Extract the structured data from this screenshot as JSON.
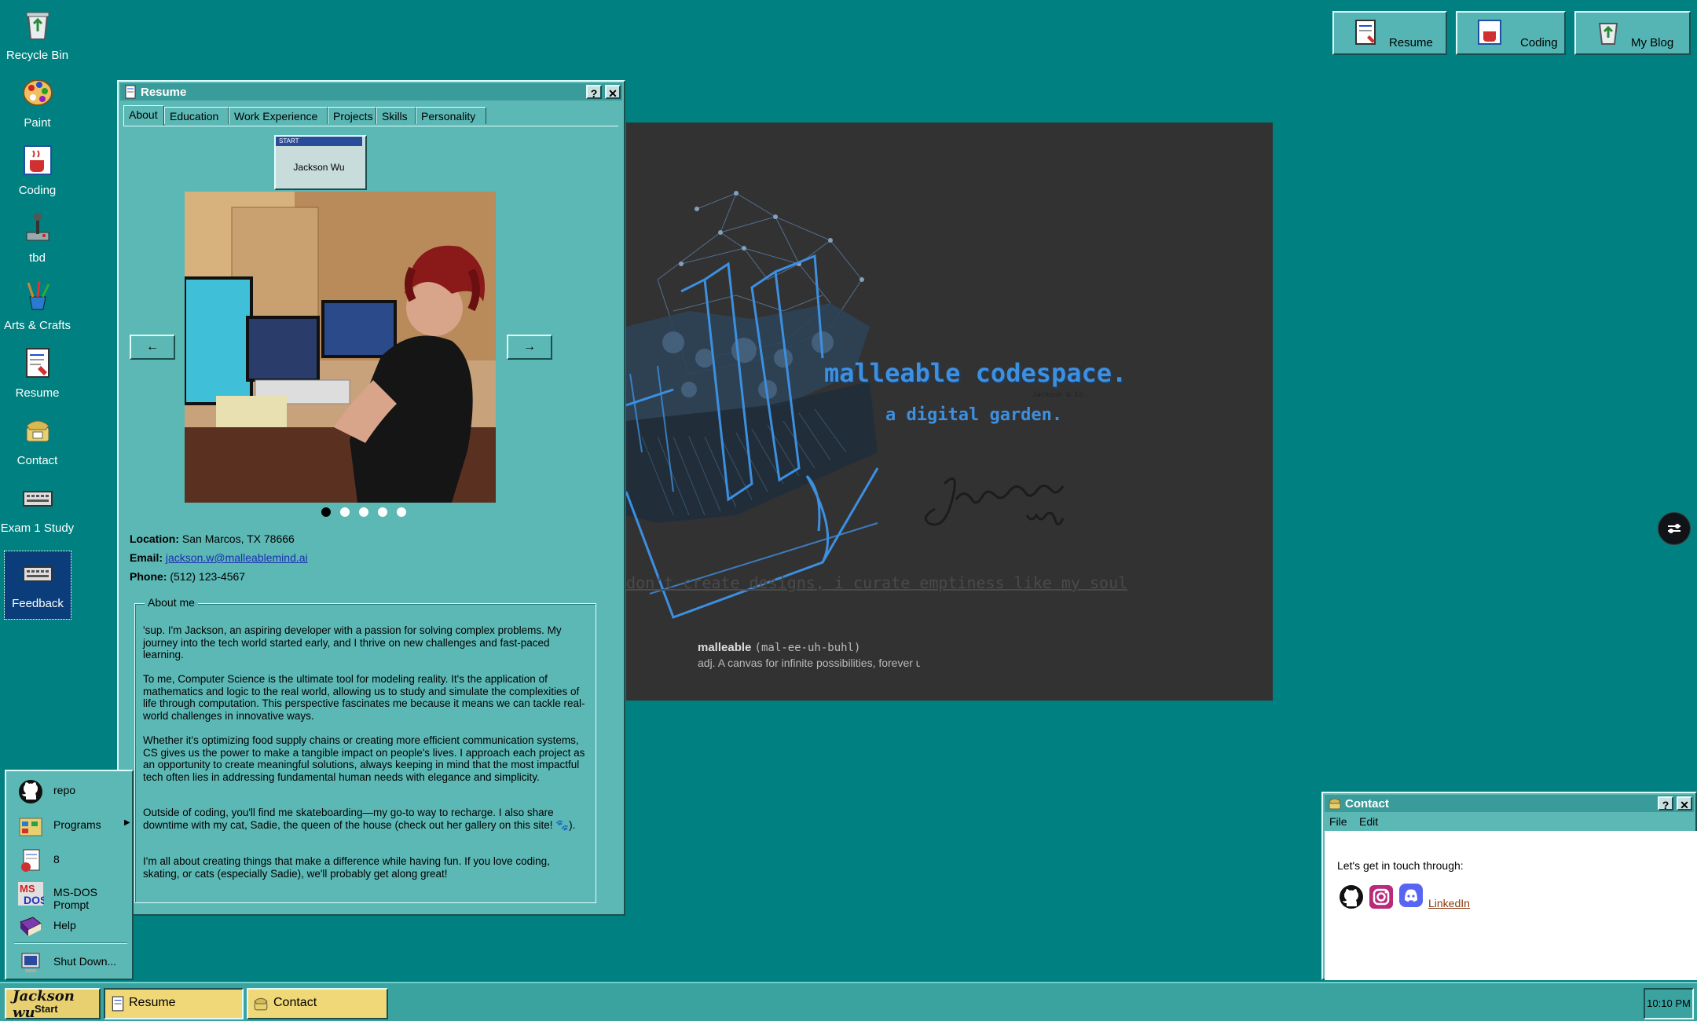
{
  "desktop": {
    "icons": [
      {
        "label": "Recycle Bin",
        "icon": "recycle-bin-icon"
      },
      {
        "label": "Paint",
        "icon": "paint-palette-icon"
      },
      {
        "label": "Coding",
        "icon": "coding-cup-icon"
      },
      {
        "label": "tbd",
        "icon": "joystick-icon"
      },
      {
        "label": "Arts & Crafts",
        "icon": "brushes-icon"
      },
      {
        "label": "Resume",
        "icon": "document-icon"
      },
      {
        "label": "Contact",
        "icon": "phone-icon"
      },
      {
        "label": "Exam 1 Study",
        "icon": "keyboard-icon"
      },
      {
        "label": "Feedback",
        "icon": "keyboard-icon"
      }
    ]
  },
  "quick_launch": [
    {
      "label": "Resume",
      "icon": "document-icon"
    },
    {
      "label": "Coding",
      "icon": "coding-cup-icon"
    },
    {
      "label": "My Blog",
      "icon": "recycle-bin-icon"
    }
  ],
  "resume_window": {
    "title": "Resume",
    "help": "?",
    "close": "✕",
    "tabs": [
      "About",
      "Education",
      "Work Experience",
      "Projects",
      "Skills",
      "Personality"
    ],
    "name_card": {
      "start": "START",
      "name": "Jackson Wu"
    },
    "prev": "←",
    "next": "→",
    "photo_count": 5,
    "photo_active": 1,
    "location_label": "Location:",
    "location": "San Marcos, TX 78666",
    "email_label": "Email:",
    "email": "jackson.w@malleablemind.ai",
    "phone_label": "Phone:",
    "phone": "(512) 123-4567",
    "about_legend": "About me",
    "paragraphs": [
      "'sup. I'm Jackson, an aspiring developer with a passion for solving complex problems. My journey into the tech world started early, and I thrive on new challenges and fast-paced learning.",
      "To me, Computer Science is the ultimate tool for modeling reality. It's the application of mathematics and logic to the real world, allowing us to study and simulate the complexities of life through computation. This perspective fascinates me because it means we can tackle real-world challenges in innovative ways.",
      "Whether it's optimizing food supply chains or creating more efficient communication systems, CS gives us the power to make a tangible impact on people's lives. I approach each project as an opportunity to create meaningful solutions, always keeping in mind that the most impactful tech often lies in addressing fundamental human needs with elegance and simplicity.",
      "Outside of coding, you'll find me skateboarding—my go-to way to recharge. I also share downtime with my cat, Sadie, the queen of the house (check out her gallery on this site! 🐾).",
      "I'm all about creating things that make a difference while having fun. If you love coding, skating, or cats (especially Sadie), we'll probably get along great!"
    ]
  },
  "hero": {
    "title": "malleable codespace.",
    "small_caption": "Jackson & Co.",
    "subtitle": "a digital garden.",
    "signature": "Jackson wu",
    "tagline": "don't create designs, i curate emptiness like my soul",
    "word": "malleable",
    "pronunciation": "(mal-ee-uh-buhl)",
    "definition": "adj. A canvas for infinite possibilities, forever u"
  },
  "start_menu": {
    "items": [
      {
        "label": "repo",
        "icon": "github-icon"
      },
      {
        "label": "Programs",
        "icon": "programs-folder-icon",
        "submenu": "▶"
      },
      {
        "label": "8",
        "icon": "documents-icon"
      },
      {
        "label": "MS-DOS Prompt",
        "icon": "msdos-icon"
      },
      {
        "label": "Help",
        "icon": "help-book-icon"
      },
      {
        "label": "Shut Down...",
        "icon": "shutdown-icon"
      }
    ]
  },
  "contact_window": {
    "title": "Contact",
    "help": "?",
    "close": "✕",
    "menu": [
      "File",
      "Edit"
    ],
    "intro": "Let's get in touch through:",
    "linkedin": "LinkedIn"
  },
  "taskbar": {
    "start_label": "Start",
    "start_logo_text": "Jackson wu",
    "tasks": [
      {
        "label": "Resume",
        "icon": "document-icon"
      },
      {
        "label": "Contact",
        "icon": "phone-icon"
      }
    ],
    "clock": "10:10 PM"
  },
  "colors": {
    "desktop": "#008080",
    "window_face": "#5cb8b5",
    "titlebar": "#3a9c9a",
    "hero_bg": "#333232",
    "hero_accent": "#3d8fe0",
    "taskbar": "#3aa3a0",
    "task_active": "#f0d878"
  }
}
